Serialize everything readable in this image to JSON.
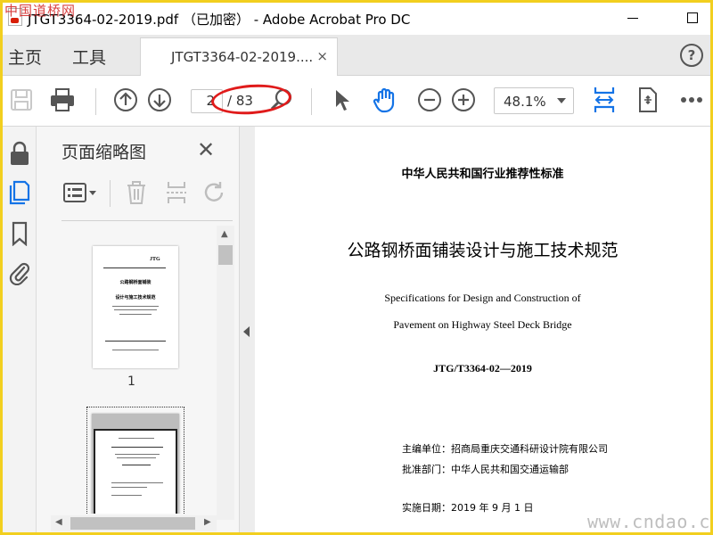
{
  "window": {
    "title": "JTGT3364-02-2019.pdf （已加密） - Adobe Acrobat Pro DC",
    "watermark_top_left": "中国道桥网",
    "watermark_bottom_right": "www.cndao.com"
  },
  "tabbar": {
    "home_label": "主页",
    "tools_label": "工具",
    "doc_tab_label": "JTGT3364-02-2019....",
    "doc_tab_close": "×",
    "help_label": "?"
  },
  "toolbar": {
    "current_page": "2",
    "page_total": "/ 83",
    "zoom_label": "48.1%"
  },
  "thumbnail_panel": {
    "title": "页面缩略图",
    "close_label": "✕",
    "page1_number": "1",
    "page1_mini": {
      "jtg": "JTG",
      "title": "公路钢桥面铺装",
      "subtitle": "设计与施工技术规范"
    }
  },
  "document": {
    "standard_line": "中华人民共和国行业推荐性标准",
    "title": "公路钢桥面铺装设计与施工技术规范",
    "english_line1": "Specifications for Design and Construction of",
    "english_line2": "Pavement on Highway Steel Deck Bridge",
    "code": "JTG/T3364-02—2019",
    "editor_line": "主编单位：招商局重庆交通科研设计院有限公司",
    "approver_line": "批准部门：中华人民共和国交通运输部",
    "date_line": "实施日期：2019 年 9 月 1 日"
  },
  "colors": {
    "frame_border": "#f2cf1f",
    "highlight_oval": "#e01b1b",
    "accent_blue": "#1473e6"
  }
}
